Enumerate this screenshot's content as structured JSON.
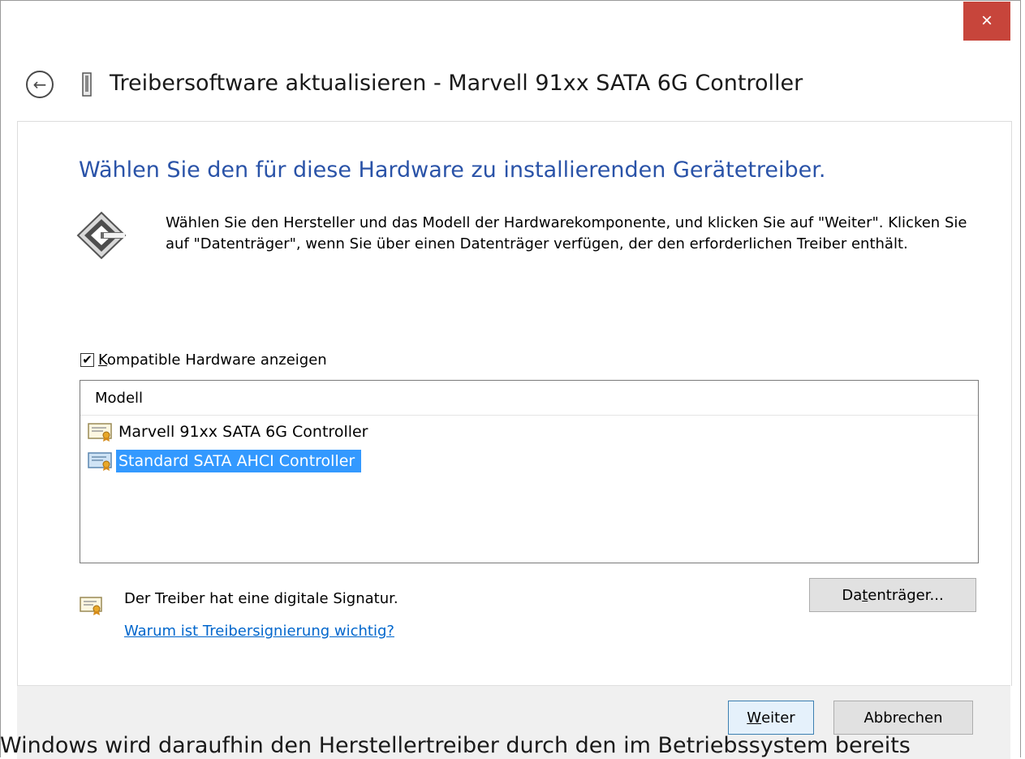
{
  "window": {
    "title": "Treibersoftware aktualisieren - Marvell 91xx SATA 6G Controller",
    "close_label": "×"
  },
  "heading": "Wählen Sie den für diese Hardware zu installierenden Gerätetreiber.",
  "description": "Wählen Sie den Hersteller und das Modell der Hardwarekomponente, und klicken Sie auf \"Weiter\". Klicken Sie auf \"Datenträger\", wenn Sie über einen Datenträger verfügen, der den erforderlichen Treiber enthält.",
  "compatible_checkbox": {
    "label_accel": "K",
    "label_rest": "ompatible Hardware anzeigen",
    "checked": true
  },
  "list": {
    "header": "Modell",
    "items": [
      {
        "label": "Marvell 91xx SATA 6G Controller",
        "selected": false
      },
      {
        "label": "Standard SATA AHCI Controller",
        "selected": true
      }
    ]
  },
  "signature": {
    "text": "Der Treiber hat eine digitale Signatur.",
    "link": "Warum ist Treibersignierung wichtig?"
  },
  "buttons": {
    "disk_pre": "Da",
    "disk_accel": "t",
    "disk_post": "enträger...",
    "next_accel": "W",
    "next_rest": "eiter",
    "cancel": "Abbrechen"
  },
  "background_text": "Windows wird daraufhin den Herstellertreiber durch den im Betriebssystem bereits",
  "colors": {
    "heading": "#2a53a8",
    "close_button": "#c7453b",
    "selection": "#3399ff",
    "link": "#0066cc"
  }
}
